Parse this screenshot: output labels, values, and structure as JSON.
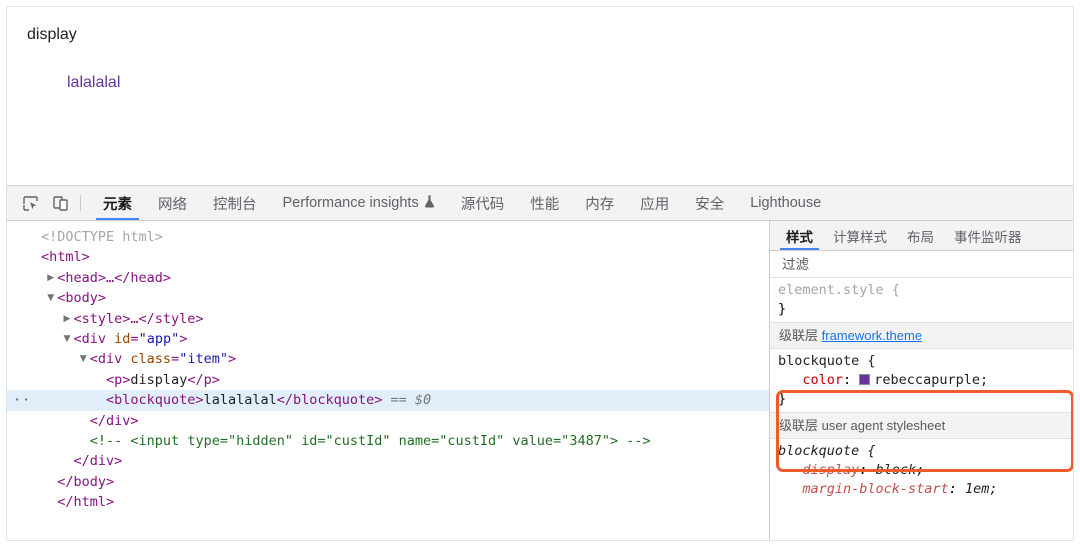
{
  "page": {
    "paragraph_text": "display",
    "blockquote_text": "lalalalal",
    "blockquote_color": "#663399"
  },
  "devtools": {
    "toolbar": {
      "inspect_icon": "inspect-element-icon",
      "device_icon": "device-toolbar-icon",
      "tabs": [
        {
          "label": "元素",
          "active": true
        },
        {
          "label": "网络",
          "active": false
        },
        {
          "label": "控制台",
          "active": false
        },
        {
          "label": "Performance insights",
          "active": false,
          "icon": "flask-icon"
        },
        {
          "label": "源代码",
          "active": false
        },
        {
          "label": "性能",
          "active": false
        },
        {
          "label": "内存",
          "active": false
        },
        {
          "label": "应用",
          "active": false
        },
        {
          "label": "安全",
          "active": false
        },
        {
          "label": "Lighthouse",
          "active": false
        }
      ]
    },
    "dom_tree": [
      {
        "indent": 0,
        "twisty": "",
        "selected": false,
        "parts": [
          {
            "t": "doctype",
            "v": "<!DOCTYPE html>"
          }
        ]
      },
      {
        "indent": 0,
        "twisty": "",
        "selected": false,
        "parts": [
          {
            "t": "tag",
            "v": "<html>"
          }
        ]
      },
      {
        "indent": 1,
        "twisty": "closed",
        "selected": false,
        "parts": [
          {
            "t": "tag",
            "v": "<head>…</head>"
          }
        ]
      },
      {
        "indent": 1,
        "twisty": "open",
        "selected": false,
        "parts": [
          {
            "t": "tag",
            "v": "<body>"
          }
        ]
      },
      {
        "indent": 2,
        "twisty": "closed",
        "selected": false,
        "parts": [
          {
            "t": "tag",
            "v": "<style>…</style>"
          }
        ]
      },
      {
        "indent": 2,
        "twisty": "open",
        "selected": false,
        "parts": [
          {
            "t": "tag",
            "v": "<div "
          },
          {
            "t": "attr",
            "v": "id"
          },
          {
            "t": "tag",
            "v": "="
          },
          {
            "t": "val",
            "v": "\"app\""
          },
          {
            "t": "tag",
            "v": ">"
          }
        ]
      },
      {
        "indent": 3,
        "twisty": "open",
        "selected": false,
        "parts": [
          {
            "t": "tag",
            "v": "<div "
          },
          {
            "t": "attr",
            "v": "class"
          },
          {
            "t": "tag",
            "v": "="
          },
          {
            "t": "val",
            "v": "\"item\""
          },
          {
            "t": "tag",
            "v": ">"
          }
        ]
      },
      {
        "indent": 4,
        "twisty": "",
        "selected": false,
        "parts": [
          {
            "t": "tag",
            "v": "<p>"
          },
          {
            "t": "text",
            "v": "display"
          },
          {
            "t": "tag",
            "v": "</p>"
          }
        ]
      },
      {
        "indent": 4,
        "twisty": "",
        "selected": true,
        "gutter": "··",
        "parts": [
          {
            "t": "tag",
            "v": "<blockquote>"
          },
          {
            "t": "text",
            "v": "lalalalal"
          },
          {
            "t": "tag",
            "v": "</blockquote>"
          },
          {
            "t": "dollar",
            "v": " == $0"
          }
        ]
      },
      {
        "indent": 3,
        "twisty": "",
        "selected": false,
        "parts": [
          {
            "t": "tag",
            "v": "</div>"
          }
        ]
      },
      {
        "indent": 3,
        "twisty": "",
        "selected": false,
        "parts": [
          {
            "t": "comment",
            "v": "<!-- <input type=\"hidden\" id=\"custId\" name=\"custId\" value=\"3487\"> -->"
          }
        ]
      },
      {
        "indent": 2,
        "twisty": "",
        "selected": false,
        "parts": [
          {
            "t": "tag",
            "v": "</div>"
          }
        ]
      },
      {
        "indent": 1,
        "twisty": "",
        "selected": false,
        "parts": [
          {
            "t": "tag",
            "v": "</body>"
          }
        ]
      },
      {
        "indent": 1,
        "twisty": "",
        "selected": false,
        "parts": [
          {
            "t": "tag",
            "v": "</html>"
          }
        ]
      }
    ],
    "styles": {
      "tabs": [
        {
          "label": "样式",
          "active": true
        },
        {
          "label": "计算样式",
          "active": false
        },
        {
          "label": "布局",
          "active": false
        },
        {
          "label": "事件监听器",
          "active": false
        }
      ],
      "filter_placeholder": "过滤",
      "filter_value": "",
      "element_style": {
        "selector": "element.style {",
        "close": "}"
      },
      "rules": [
        {
          "layer_label": "级联层",
          "layer_link": "framework.theme",
          "layer_is_link": true,
          "selector": "blockquote {",
          "close": "}",
          "italic": false,
          "highlighted": true,
          "declarations": [
            {
              "property": "color",
              "value": "rebeccapurple",
              "swatch": "#663399"
            }
          ]
        },
        {
          "layer_label": "级联层",
          "layer_link": "user agent stylesheet",
          "layer_is_link": false,
          "selector": "blockquote {",
          "close": "",
          "italic": true,
          "highlighted": false,
          "declarations": [
            {
              "property": "display",
              "value": "block",
              "swatch": null
            },
            {
              "property": "margin-block-start",
              "value": "1em",
              "swatch": null
            }
          ]
        }
      ]
    }
  }
}
